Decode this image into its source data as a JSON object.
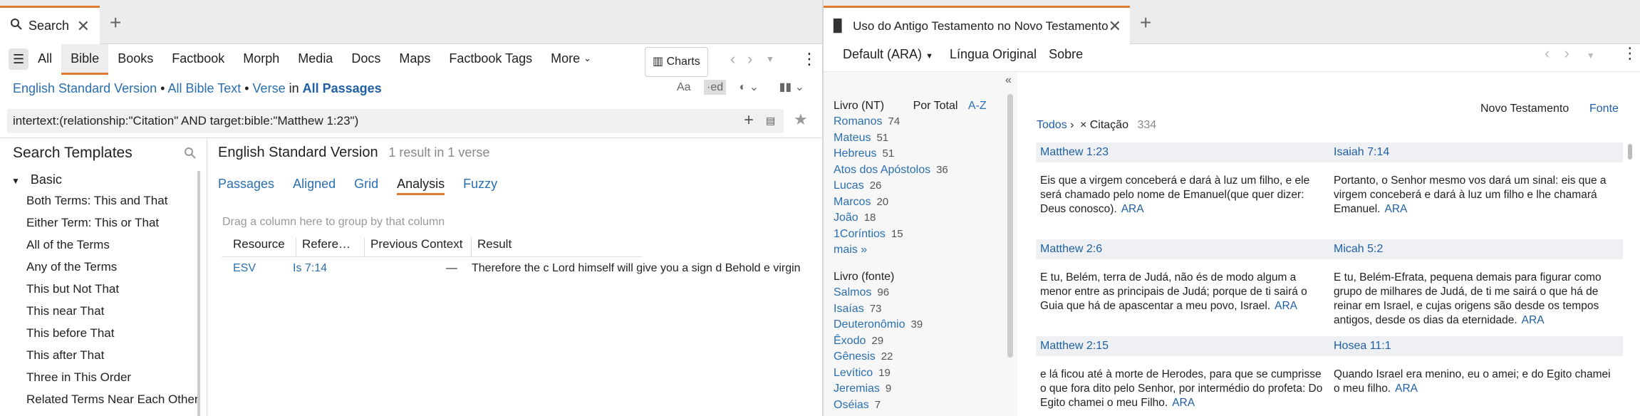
{
  "left_tab": {
    "title": "Search"
  },
  "right_tab": {
    "title": "Uso do Antigo Testamento no Novo Testamento"
  },
  "left_nav": {
    "items": [
      "All",
      "Bible",
      "Books",
      "Factbook",
      "Morph",
      "Media",
      "Docs",
      "Maps",
      "Factbook Tags",
      "More"
    ],
    "charts": "Charts"
  },
  "scope": {
    "version": "English Standard Version",
    "sep1": "•",
    "text": "All Bible Text",
    "sep2": "•",
    "unit": "Verse",
    "in": "in",
    "passages": "All Passages"
  },
  "query": "intertext:(relationship:\"Citation\" AND target:bible:\"Matthew 1:23\")",
  "templates": {
    "title": "Search Templates",
    "group": "Basic",
    "items": [
      "Both Terms: This and That",
      "Either Term: This or That",
      "All of the Terms",
      "Any of the Terms",
      "This but Not That",
      "This near That",
      "This before That",
      "This after That",
      "Three in This Order",
      "Related Terms Near Each Other"
    ]
  },
  "results": {
    "title": "English Standard Version",
    "count": "1 result in 1 verse",
    "views": [
      "Passages",
      "Aligned",
      "Grid",
      "Analysis",
      "Fuzzy"
    ],
    "group_hint": "Drag a column here to group by that column",
    "columns": [
      "Resource",
      "Refere…",
      "Previous Context",
      "Result"
    ],
    "row": {
      "resource": "ESV",
      "reference": "Is 7:14",
      "previous": "—",
      "result": "Therefore the c  Lord himself will give you a sign d Behold e virgin"
    }
  },
  "right_nav": {
    "default": "Default (ARA)",
    "original": "Língua Original",
    "about": "Sobre"
  },
  "facets": {
    "nt_header": "Livro (NT)",
    "by_total": "Por Total",
    "az": "A-Z",
    "nt": [
      [
        "Romanos",
        "74"
      ],
      [
        "Mateus",
        "51"
      ],
      [
        "Hebreus",
        "51"
      ],
      [
        "Atos dos Apóstolos",
        "36"
      ],
      [
        "Lucas",
        "26"
      ],
      [
        "Marcos",
        "20"
      ],
      [
        "João",
        "18"
      ],
      [
        "1Coríntios",
        "15"
      ]
    ],
    "more": "mais »",
    "src_header": "Livro (fonte)",
    "src": [
      [
        "Salmos",
        "96"
      ],
      [
        "Isaías",
        "73"
      ],
      [
        "Deuteronômio",
        "39"
      ],
      [
        "Êxodo",
        "29"
      ],
      [
        "Gênesis",
        "22"
      ],
      [
        "Levítico",
        "19"
      ],
      [
        "Jeremias",
        "9"
      ],
      [
        "Oséias",
        "7"
      ]
    ],
    "collapse": "«"
  },
  "main": {
    "nt_label": "Novo Testamento",
    "src_label": "Fonte",
    "crumb_all": "Todos",
    "crumb_sep": "›",
    "crumb_filter": "× Citação",
    "crumb_count": "334",
    "pairs": [
      {
        "nt_ref": "Matthew 1:23",
        "nt_text": "Eis que a virgem conceberá e dará à luz um filho, e ele será chamado pelo nome de Emanuel(que quer dizer: Deus conosco).",
        "ot_ref": "Isaiah 7:14",
        "ot_text": "Portanto, o Senhor mesmo vos dará um sinal: eis que a virgem conceberá e dará à luz um filho e lhe chamará Emanuel."
      },
      {
        "nt_ref": "Matthew 2:6",
        "nt_text": "E tu, Belém, terra de Judá, não és de modo algum a menor entre as principais de Judá; porque de ti sairá o Guia que há de apascentar a meu povo, Israel.",
        "ot_ref": "Micah 5:2",
        "ot_text": "E tu, Belém-Efrata, pequena demais para figurar como grupo de milhares de Judá, de ti me sairá o que há de reinar em Israel, e cujas origens são desde os tempos antigos, desde os dias da eternidade."
      },
      {
        "nt_ref": "Matthew 2:15",
        "nt_text": "e lá ficou até à morte de Herodes, para que se cumprisse o que fora dito pelo Senhor, por intermédio do profeta: Do Egito chamei o meu Filho.",
        "ot_ref": "Hosea 11:1",
        "ot_text": "Quando Israel era menino, eu o amei; e do Egito chamei o meu filho."
      }
    ],
    "ara": "ARA"
  }
}
